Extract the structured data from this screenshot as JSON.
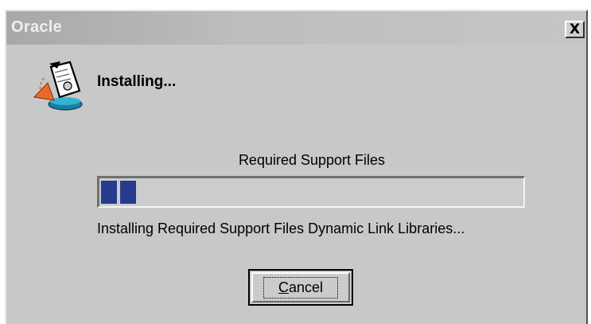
{
  "window": {
    "title": "Oracle",
    "close_glyph": "X"
  },
  "header": {
    "icon": "install-document-icon",
    "heading": "Installing..."
  },
  "progress": {
    "label": "Required Support Files",
    "fraction": 0.09,
    "fill_color": "#273b8e",
    "status_text": "Installing Required Support Files Dynamic Link Libraries..."
  },
  "buttons": {
    "cancel_mnemonic": "C",
    "cancel_rest": "ancel"
  }
}
